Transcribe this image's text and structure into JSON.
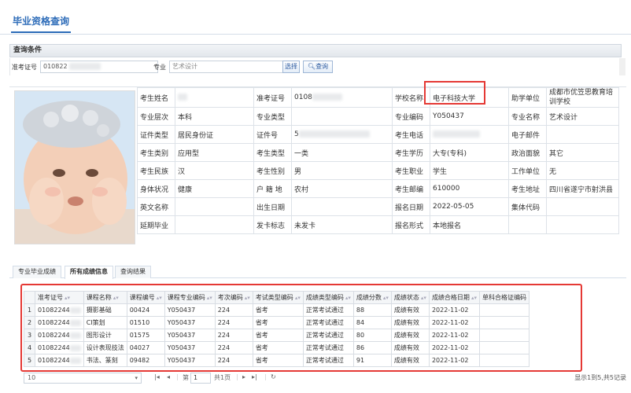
{
  "page": {
    "title": "毕业资格查询"
  },
  "query": {
    "header": "查询条件",
    "exam_no_label": "准考证号",
    "exam_no_value": "010822",
    "major_label": "专业",
    "major_value": "艺术设计",
    "select_button": "选择",
    "search_button": "查询"
  },
  "student": {
    "name_label": "考生姓名",
    "name_value": "",
    "exam_no_label": "准考证号",
    "exam_no_value": "0108",
    "school_label": "学校名称",
    "school_value": "电子科技大学",
    "assist_label": "助学单位",
    "assist_value": "成都市优笠思教育培训学校",
    "level_label": "专业层次",
    "level_value": "本科",
    "major_type_label": "专业类型",
    "major_type_value": "",
    "major_code_label": "专业编码",
    "major_code_value": "Y050437",
    "major_name_label": "专业名称",
    "major_name_value": "艺术设计",
    "id_type_label": "证件类型",
    "id_type_value": "居民身份证",
    "id_no_label": "证件号",
    "id_no_value": "5",
    "phone_label": "考生电话",
    "phone_value": "",
    "email_label": "电子邮件",
    "email_value": "",
    "category_label": "考生类别",
    "category_value": "应用型",
    "stu_type_label": "考生类型",
    "stu_type_value": "一类",
    "education_label": "考生学历",
    "education_value": "大专(专科)",
    "politics_label": "政治面貌",
    "politics_value": "其它",
    "nation_label": "考生民族",
    "nation_value": "汉",
    "gender_label": "考生性别",
    "gender_value": "男",
    "job_label": "考生职业",
    "job_value": "学生",
    "work_unit_label": "工作单位",
    "work_unit_value": "无",
    "health_label": "身体状况",
    "health_value": "健康",
    "hukou_label": "户 籍 地",
    "hukou_value": "农村",
    "postcode_label": "考生邮编",
    "postcode_value": "610000",
    "address_label": "考生地址",
    "address_value": "四川省遂宁市射洪县",
    "english_name_label": "英文名称",
    "english_name_value": "",
    "birth_label": "出生日期",
    "birth_value": "",
    "reg_date_label": "报名日期",
    "reg_date_value": "2022-05-05",
    "group_code_label": "集体代码",
    "group_code_value": "",
    "delay_label": "延期毕业",
    "delay_value": "",
    "card_label": "发卡标志",
    "card_value": "未发卡",
    "reg_form_label": "报名形式",
    "reg_form_value": "本地报名"
  },
  "tabs": [
    "专业毕业成绩",
    "所有成绩信息",
    "查询结果"
  ],
  "grid": {
    "columns": [
      "准考证号",
      "课程名称",
      "课程编号",
      "课程专业编码",
      "考次编码",
      "考试类型编码",
      "成绩类型编码",
      "成绩分数",
      "成绩状态",
      "成绩合格日期",
      "单科合格证编码"
    ],
    "rows": [
      {
        "no": "1",
        "exam_no": "01082244",
        "course": "摄影基础",
        "course_no": "00424",
        "major_code": "Y050437",
        "exam_code": "224",
        "exam_type": "省考",
        "score_type": "正常考试通过",
        "score": "88",
        "status": "成绩有效",
        "date": "2022-11-02",
        "cert": ""
      },
      {
        "no": "2",
        "exam_no": "01082244",
        "course": "CI策划",
        "course_no": "01510",
        "major_code": "Y050437",
        "exam_code": "224",
        "exam_type": "省考",
        "score_type": "正常考试通过",
        "score": "84",
        "status": "成绩有效",
        "date": "2022-11-02",
        "cert": ""
      },
      {
        "no": "3",
        "exam_no": "01082244",
        "course": "图形设计",
        "course_no": "01575",
        "major_code": "Y050437",
        "exam_code": "224",
        "exam_type": "省考",
        "score_type": "正常考试通过",
        "score": "80",
        "status": "成绩有效",
        "date": "2022-11-02",
        "cert": ""
      },
      {
        "no": "4",
        "exam_no": "01082244",
        "course": "设计表现技法",
        "course_no": "04027",
        "major_code": "Y050437",
        "exam_code": "224",
        "exam_type": "省考",
        "score_type": "正常考试通过",
        "score": "86",
        "status": "成绩有效",
        "date": "2022-11-02",
        "cert": ""
      },
      {
        "no": "5",
        "exam_no": "01082244",
        "course": "书法、篆刻",
        "course_no": "09482",
        "major_code": "Y050437",
        "exam_code": "224",
        "exam_type": "省考",
        "score_type": "正常考试通过",
        "score": "91",
        "status": "成绩有效",
        "date": "2022-11-02",
        "cert": ""
      }
    ]
  },
  "pager": {
    "page_size": "10",
    "page_label": "第",
    "page_value": "1",
    "total_pages": "共1页",
    "summary": "显示1到5,共5记录"
  },
  "colors": {
    "accent": "#2c6bb8",
    "highlight": "#e53935"
  }
}
